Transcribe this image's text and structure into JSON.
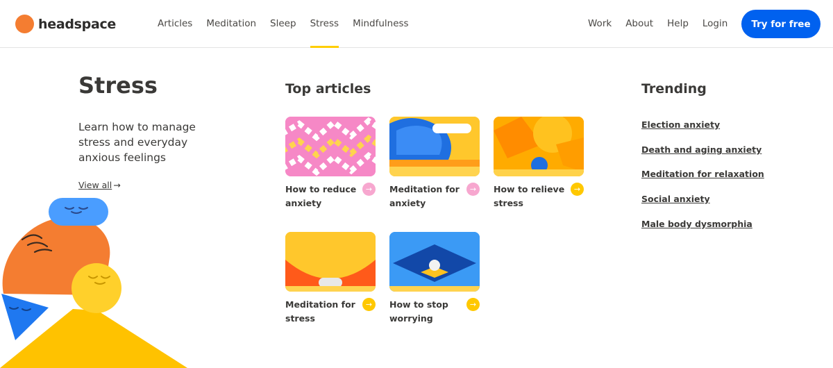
{
  "header": {
    "logo_text": "headspace",
    "nav_left": [
      "Articles",
      "Meditation",
      "Sleep",
      "Stress",
      "Mindfulness"
    ],
    "active_nav": "Stress",
    "nav_right": [
      "Work",
      "About",
      "Help",
      "Login"
    ],
    "cta_label": "Try for free"
  },
  "intro": {
    "title": "Stress",
    "description": "Learn how to manage stress and everyday anxious feelings",
    "view_all": "View all"
  },
  "top_articles": {
    "title": "Top articles",
    "items": [
      {
        "label": "How to reduce anxiety",
        "arrow_color": "#f7a7cf"
      },
      {
        "label": "Meditation for anxiety",
        "arrow_color": "#f7a7cf"
      },
      {
        "label": "How to relieve stress",
        "arrow_color": "#ffc800"
      },
      {
        "label": "Meditation for stress",
        "arrow_color": "#ffc800"
      },
      {
        "label": "How to stop worrying",
        "arrow_color": "#ffc800"
      }
    ]
  },
  "trending": {
    "title": "Trending",
    "links": [
      "Election anxiety",
      "Death and aging anxiety",
      "Meditation for relaxation",
      "Social anxiety",
      "Male body dysmorphia"
    ]
  },
  "colors": {
    "brand_orange": "#f47d31",
    "cta_blue": "#0061ef",
    "active_underline": "#ffce00"
  }
}
